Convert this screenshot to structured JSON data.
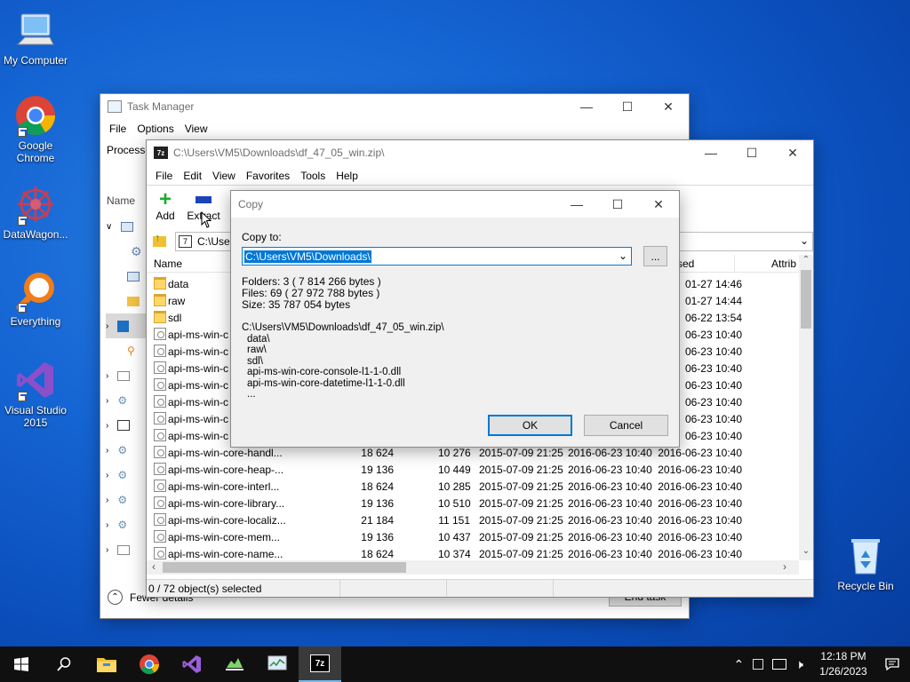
{
  "desktop": {
    "icons": [
      {
        "label": "My Computer"
      },
      {
        "label": "Google Chrome"
      },
      {
        "label": "DataWagon..."
      },
      {
        "label": "Everything"
      },
      {
        "label": "Visual Studio 2015"
      },
      {
        "label": "Recycle Bin"
      }
    ]
  },
  "task_manager": {
    "title": "Task Manager",
    "menu": [
      "File",
      "Options",
      "View"
    ],
    "tab_partial": "Processe",
    "col_name": "Name",
    "fewer_details": "Fewer details",
    "end_task": "End task"
  },
  "zip": {
    "title": "C:\\Users\\VM5\\Downloads\\df_47_05_win.zip\\",
    "menu": [
      "File",
      "Edit",
      "View",
      "Favorites",
      "Tools",
      "Help"
    ],
    "toolbar": {
      "add": "Add",
      "extract": "Extract"
    },
    "address": "C:\\User",
    "columns": {
      "name": "Name",
      "accessed_partial": "sed",
      "attrib": "Attrib"
    },
    "rows": [
      {
        "name": "data",
        "type": "folder",
        "size": "",
        "packed": "",
        "modified": "",
        "created": "",
        "accessed": "01-27 14:46"
      },
      {
        "name": "raw",
        "type": "folder",
        "size": "",
        "packed": "",
        "modified": "",
        "created": "",
        "accessed": "01-27 14:44"
      },
      {
        "name": "sdl",
        "type": "folder",
        "size": "",
        "packed": "",
        "modified": "",
        "created": "",
        "accessed": "06-22 13:54"
      },
      {
        "name": "api-ms-win-c",
        "type": "dll",
        "size": "",
        "packed": "",
        "modified": "",
        "created": "",
        "accessed": "06-23 10:40"
      },
      {
        "name": "api-ms-win-c",
        "type": "dll",
        "size": "",
        "packed": "",
        "modified": "",
        "created": "",
        "accessed": "06-23 10:40"
      },
      {
        "name": "api-ms-win-c",
        "type": "dll",
        "size": "",
        "packed": "",
        "modified": "",
        "created": "",
        "accessed": "06-23 10:40"
      },
      {
        "name": "api-ms-win-c",
        "type": "dll",
        "size": "",
        "packed": "",
        "modified": "",
        "created": "",
        "accessed": "06-23 10:40"
      },
      {
        "name": "api-ms-win-c",
        "type": "dll",
        "size": "",
        "packed": "",
        "modified": "",
        "created": "",
        "accessed": "06-23 10:40"
      },
      {
        "name": "api-ms-win-c",
        "type": "dll",
        "size": "",
        "packed": "",
        "modified": "",
        "created": "",
        "accessed": "06-23 10:40"
      },
      {
        "name": "api-ms-win-c",
        "type": "dll",
        "size": "",
        "packed": "",
        "modified": "",
        "created": "",
        "accessed": "06-23 10:40"
      },
      {
        "name": "api-ms-win-core-handl...",
        "type": "dll",
        "size": "18 624",
        "packed": "10 276",
        "modified": "2015-07-09 21:25",
        "created": "2016-06-23 10:40",
        "accessed": "2016-06-23 10:40"
      },
      {
        "name": "api-ms-win-core-heap-...",
        "type": "dll",
        "size": "19 136",
        "packed": "10 449",
        "modified": "2015-07-09 21:25",
        "created": "2016-06-23 10:40",
        "accessed": "2016-06-23 10:40"
      },
      {
        "name": "api-ms-win-core-interl...",
        "type": "dll",
        "size": "18 624",
        "packed": "10 285",
        "modified": "2015-07-09 21:25",
        "created": "2016-06-23 10:40",
        "accessed": "2016-06-23 10:40"
      },
      {
        "name": "api-ms-win-core-library...",
        "type": "dll",
        "size": "19 136",
        "packed": "10 510",
        "modified": "2015-07-09 21:25",
        "created": "2016-06-23 10:40",
        "accessed": "2016-06-23 10:40"
      },
      {
        "name": "api-ms-win-core-localiz...",
        "type": "dll",
        "size": "21 184",
        "packed": "11 151",
        "modified": "2015-07-09 21:25",
        "created": "2016-06-23 10:40",
        "accessed": "2016-06-23 10:40"
      },
      {
        "name": "api-ms-win-core-mem...",
        "type": "dll",
        "size": "19 136",
        "packed": "10 437",
        "modified": "2015-07-09 21:25",
        "created": "2016-06-23 10:40",
        "accessed": "2016-06-23 10:40"
      },
      {
        "name": "api-ms-win-core-name...",
        "type": "dll",
        "size": "18 624",
        "packed": "10 374",
        "modified": "2015-07-09 21:25",
        "created": "2016-06-23 10:40",
        "accessed": "2016-06-23 10:40"
      }
    ],
    "status": "0 / 72 object(s) selected"
  },
  "copy_dialog": {
    "title": "Copy",
    "copy_to_label": "Copy to:",
    "path_value": "C:\\Users\\VM5\\Downloads\\",
    "browse": "...",
    "folders": "Folders: 3    ( 7 814 266 bytes )",
    "files": "Files: 69    ( 27 972 788 bytes )",
    "size": "Size: 35 787 054 bytes",
    "source_path": "C:\\Users\\VM5\\Downloads\\df_47_05_win.zip\\",
    "items": [
      "data\\",
      "raw\\",
      "sdl\\",
      "api-ms-win-core-console-l1-1-0.dll",
      "api-ms-win-core-datetime-l1-1-0.dll",
      "..."
    ],
    "ok": "OK",
    "cancel": "Cancel"
  },
  "taskbar": {
    "time": "12:18 PM",
    "date": "1/26/2023"
  }
}
